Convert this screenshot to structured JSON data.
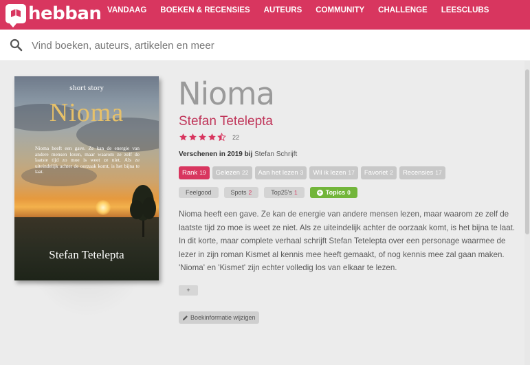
{
  "header": {
    "logo_text": "hebban",
    "nav": [
      "VANDAAG",
      "BOEKEN & RECENSIES",
      "AUTEURS",
      "COMMUNITY",
      "CHALLENGE",
      "LEESCLUBS"
    ],
    "brand_color": "#d8365f"
  },
  "search": {
    "placeholder": "Vind boeken, auteurs, artikelen en meer",
    "icon": "search-icon"
  },
  "cover": {
    "series": "short story",
    "title": "Nioma",
    "blurb": "Nioma heeft een gave. Ze kan de energie van andere mensen lezen, maar waarom ze zelf de laatste tijd zo moe is weet ze niet. Als ze uiteindelijk achter de oorzaak komt, is het bijna te laat.",
    "author": "Stefan Tetelepta"
  },
  "book": {
    "title": "Nioma",
    "author": "Stefan Tetelepta",
    "rating": 4.5,
    "rating_count": "22",
    "published_label": "Verschenen in 2019 bij",
    "publisher": "Stefan Schrijft"
  },
  "stats": [
    {
      "label": "Rank",
      "count": "19"
    },
    {
      "label": "Gelezen",
      "count": "22"
    },
    {
      "label": "Aan het lezen",
      "count": "3"
    },
    {
      "label": "Wil ik lezen",
      "count": "17"
    },
    {
      "label": "Favoriet",
      "count": "2"
    },
    {
      "label": "Recensies",
      "count": "17"
    }
  ],
  "tags": [
    {
      "label": "Feelgood",
      "count": ""
    },
    {
      "label": "Spots",
      "count": "2"
    },
    {
      "label": "Top25's",
      "count": "1"
    },
    {
      "label": "Topics",
      "count": "0"
    }
  ],
  "description": "Nioma heeft een gave. Ze kan de energie van andere mensen lezen, maar waarom ze zelf de laatste tijd zo moe is weet ze niet. Als ze uiteindelijk achter de oorzaak komt, is het bijna te laat. In dit korte, maar complete verhaal schrijft Stefan Tetelepta over een personage waarmee de lezer in zijn roman Kismet al kennis mee heeft gemaakt, of nog kennis mee zal gaan maken. 'Nioma' en 'Kismet' zijn echter volledig los van elkaar te lezen.",
  "more_label": "+",
  "edit_label": "Boekinformatie wijzigen"
}
